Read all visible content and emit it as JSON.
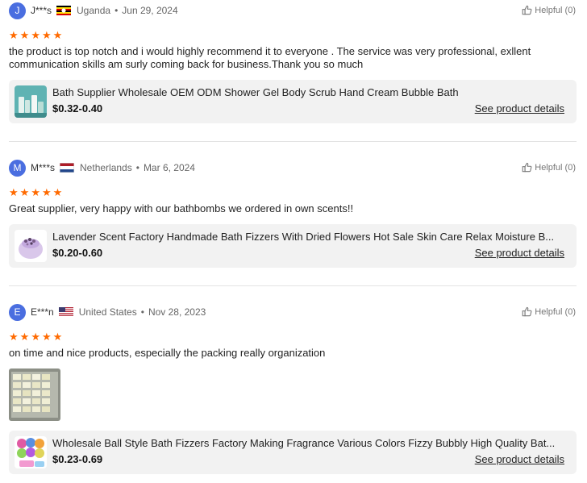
{
  "reviews": [
    {
      "avatar_letter": "J",
      "name": "J***s",
      "country": "Uganda",
      "date": "Jun 29, 2024",
      "flag_icon": "uganda-flag-icon",
      "helpful": "Helpful (0)",
      "rating": 5,
      "text": "the product is top notch and i would highly recommend it to everyone . The service was very professional, exllent communication skills am surly coming back for business.Thank you so much",
      "product": {
        "title": "Bath Supplier Wholesale OEM ODM Shower Gel Body Scrub Hand Cream Bubble Bath",
        "price": "$0.32-0.40",
        "details_link": "See product details"
      }
    },
    {
      "avatar_letter": "M",
      "name": "M***s",
      "country": "Netherlands",
      "date": "Mar 6, 2024",
      "flag_icon": "netherlands-flag-icon",
      "helpful": "Helpful (0)",
      "rating": 5,
      "text": "Great supplier, very happy with our bathbombs we ordered in own scents!!",
      "product": {
        "title": "Lavender Scent Factory Handmade Bath Fizzers With Dried Flowers Hot Sale Skin Care Relax Moisture B...",
        "price": "$0.20-0.60",
        "details_link": "See product details"
      }
    },
    {
      "avatar_letter": "E",
      "name": "E***n",
      "country": "United States",
      "date": "Nov 28, 2023",
      "flag_icon": "usa-flag-icon",
      "helpful": "Helpful (0)",
      "rating": 5,
      "text": "on time and nice products, especially the packing really organization",
      "product": {
        "title": "Wholesale Ball Style Bath Fizzers Factory Making Fragrance Various Colors Fizzy Bubbly High Quality Bat...",
        "price": "$0.23-0.69",
        "details_link": "See product details"
      }
    }
  ],
  "colors": {
    "star": "#ff6a00",
    "avatar": "#4a6ee0",
    "product_card_bg": "#f2f2f2"
  },
  "icons": {
    "star": "star-icon",
    "helpful": "thumbs-up-icon"
  },
  "separator": "•",
  "star_glyph": "★"
}
